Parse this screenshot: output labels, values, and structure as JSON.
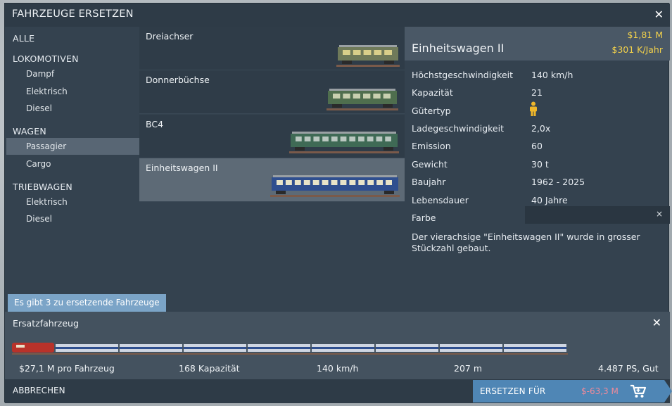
{
  "window": {
    "title": "FAHRZEUGE ERSETZEN"
  },
  "categories": {
    "all": "ALLE",
    "groups": [
      {
        "label": "LOKOMOTIVEN",
        "items": [
          "Dampf",
          "Elektrisch",
          "Diesel"
        ]
      },
      {
        "label": "WAGEN",
        "items": [
          "Passagier",
          "Cargo"
        ]
      },
      {
        "label": "TRIEBWAGEN",
        "items": [
          "Elektrisch",
          "Diesel"
        ]
      }
    ],
    "selected": "Passagier"
  },
  "vehicles": [
    {
      "name": "Dreiachser",
      "body_color": "#6f7a5a",
      "window_color": "#d9cf8a"
    },
    {
      "name": "Donnerbüchse",
      "body_color": "#4f6e4e",
      "window_color": "#c9d0b0"
    },
    {
      "name": "BC4",
      "body_color": "#3f6a55",
      "window_color": "#b9c7c0"
    },
    {
      "name": "Einheitswagen II",
      "body_color": "#2f4f8f",
      "window_color": "#e8e4c8",
      "selected": true
    }
  ],
  "details": {
    "name": "Einheitswagen II",
    "price": "$1,81 M",
    "running_cost": "$301 K/Jahr",
    "properties": [
      {
        "label": "Höchstgeschwindigkeit",
        "value": "140 km/h"
      },
      {
        "label": "Kapazität",
        "value": "21"
      },
      {
        "label": "Gütertyp",
        "value": "",
        "icon": "passenger-icon"
      },
      {
        "label": "Ladegeschwindigkeit",
        "value": "2,0x"
      },
      {
        "label": "Emission",
        "value": "60"
      },
      {
        "label": "Gewicht",
        "value": "30 t"
      },
      {
        "label": "Baujahr",
        "value": "1962 - 2025"
      },
      {
        "label": "Lebensdauer",
        "value": "40 Jahre"
      },
      {
        "label": "Farbe",
        "value": ""
      }
    ],
    "color_clear": "×",
    "description": "Der vierachsige \"Einheitswagen II\" wurde in grosser Stückzahl gebaut."
  },
  "notice": "Es gibt 3 zu ersetzende Fahrzeuge",
  "replacement": {
    "label": "Ersatzfahrzeug",
    "stats": {
      "cost": "$27,1 M pro Fahrzeug",
      "capacity": "168 Kapazität",
      "speed": "140 km/h",
      "length": "207 m",
      "power": "4.487 PS, Gut"
    },
    "wagon_count": 8,
    "loco_color": "#b8322a",
    "wagon_color": "#cfd6e2",
    "wagon_stripe": "#2f4f8f"
  },
  "footer": {
    "cancel": "ABBRECHEN",
    "replace": "ERSETZEN FÜR",
    "replace_cost": "$-63,3 M"
  },
  "colors": {
    "accent": "#4f86b5",
    "money": "#f2d14b",
    "negative": "#f08a9a",
    "notice": "#7ba4c7"
  }
}
